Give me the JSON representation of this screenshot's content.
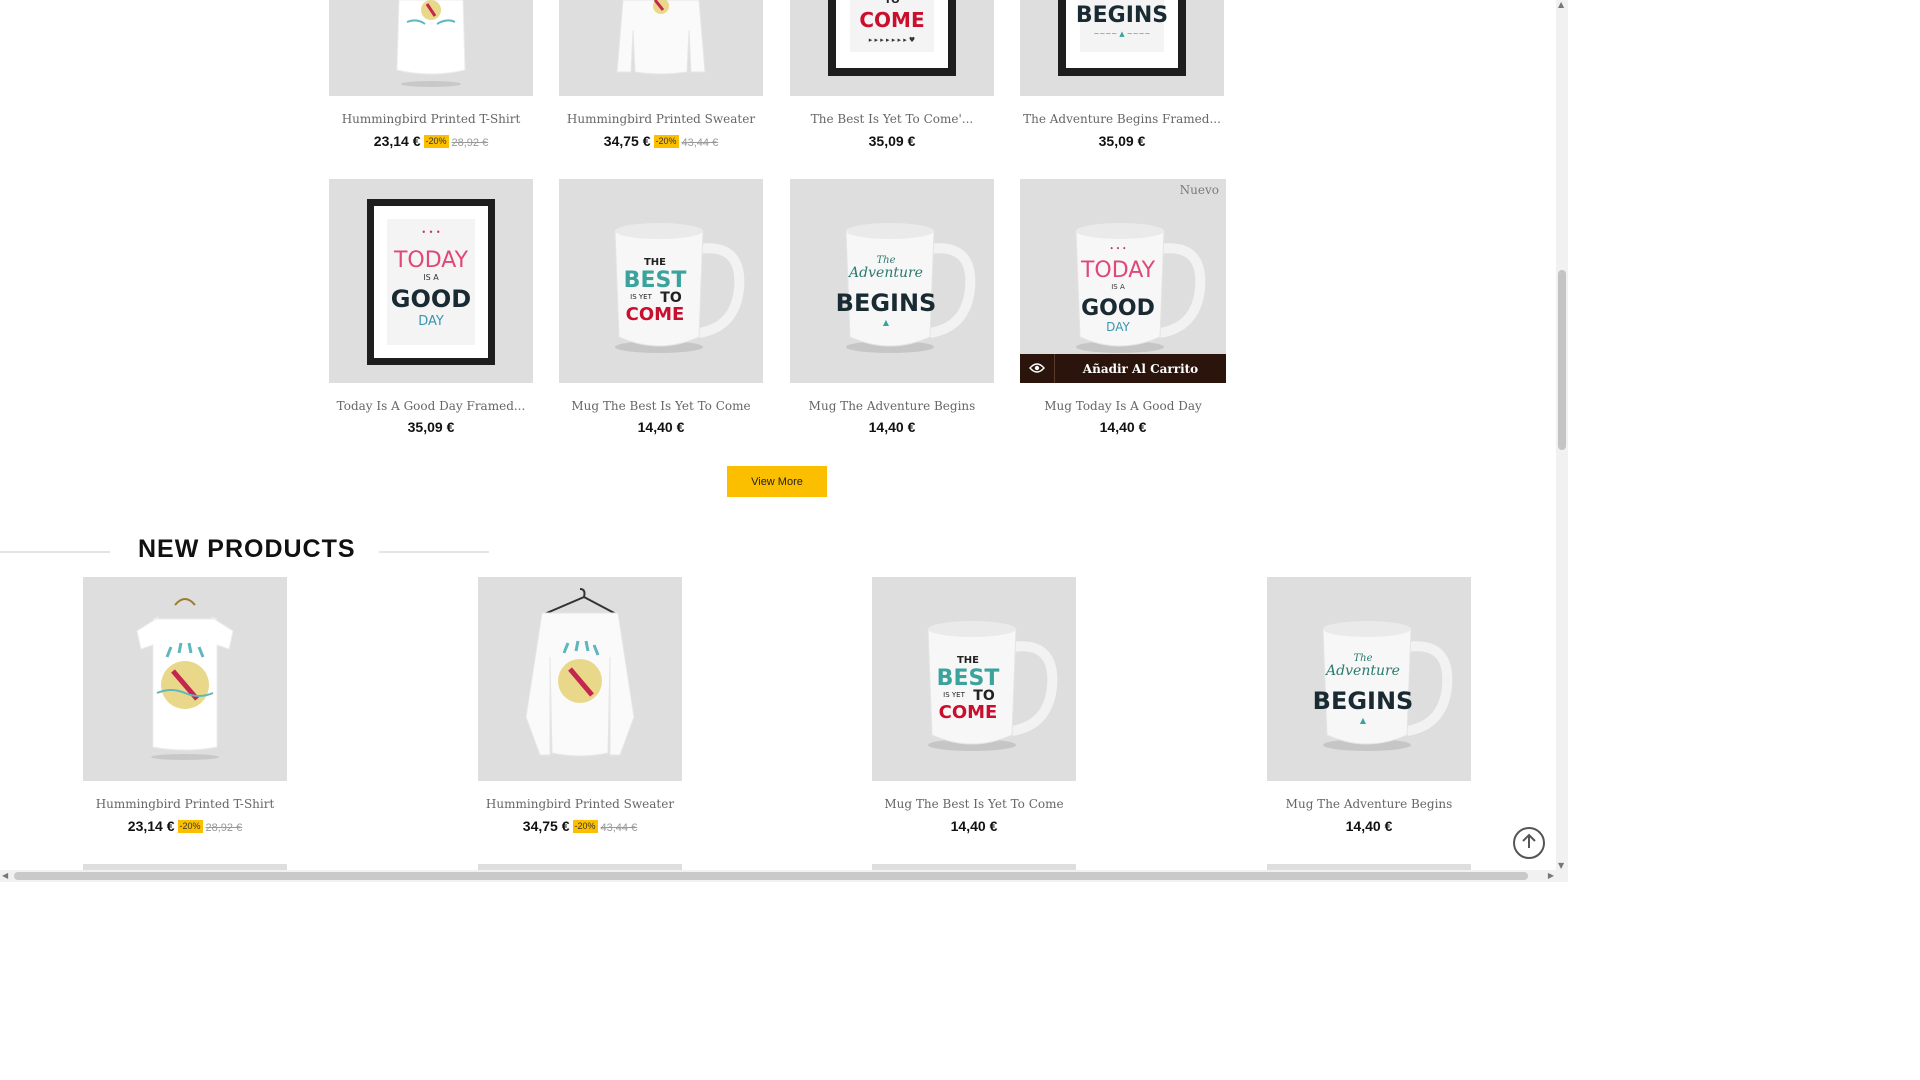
{
  "top_grid": [
    {
      "name": "Hummingbird Printed T-Shirt",
      "price": "23,14 €",
      "discount": "-20%",
      "old_price": "28,92 €",
      "image": "tshirt-hummingbird"
    },
    {
      "name": "Hummingbird Printed Sweater",
      "price": "34,75 €",
      "discount": "-20%",
      "old_price": "43,44 €",
      "image": "sweater-hummingbird"
    },
    {
      "name": "The Best Is Yet To Come'...",
      "price": "35,09 €",
      "image": "frame-best-is-yet-to-come"
    },
    {
      "name": "The Adventure Begins Framed...",
      "price": "35,09 €",
      "image": "frame-adventure-begins"
    },
    {
      "name": "Today Is A Good Day Framed...",
      "price": "35,09 €",
      "image": "frame-today-good-day"
    },
    {
      "name": "Mug The Best Is Yet To Come",
      "price": "14,40 €",
      "image": "mug-best-is-yet-to-come"
    },
    {
      "name": "Mug The Adventure Begins",
      "price": "14,40 €",
      "image": "mug-adventure-begins"
    },
    {
      "name": "Mug Today Is A Good Day",
      "price": "14,40 €",
      "badge": "Nuevo",
      "cart_label": "Añadir Al Carrito",
      "image": "mug-today-good-day"
    }
  ],
  "view_more_label": "View More",
  "new_products": {
    "title": "NEW PRODUCTS",
    "items": [
      {
        "name": "Hummingbird Printed T-Shirt",
        "price": "23,14 €",
        "discount": "-20%",
        "old_price": "28,92 €",
        "image": "tshirt-hummingbird"
      },
      {
        "name": "Hummingbird Printed Sweater",
        "price": "34,75 €",
        "discount": "-20%",
        "old_price": "43,44 €",
        "image": "sweater-hummingbird"
      },
      {
        "name": "Mug The Best Is Yet To Come",
        "price": "14,40 €",
        "image": "mug-best-is-yet-to-come"
      },
      {
        "name": "Mug The Adventure Begins",
        "price": "14,40 €",
        "image": "mug-adventure-begins"
      }
    ]
  },
  "art": {
    "frame1_top": "TO",
    "frame1_bottom": "COME",
    "frame2_top": "BEGINS",
    "today_1": "TODAY",
    "today_2": "IS A",
    "today_3": "GOOD",
    "today_4": "DAY",
    "best_1": "THE",
    "best_2": "BEST",
    "best_3": "IS YET",
    "best_4": "TO",
    "best_5": "COME",
    "adv_1": "The",
    "adv_2": "Adventure",
    "adv_3": "BEGINS"
  },
  "icons": {
    "eye": "eye-icon",
    "to_top": "arrow-up-circle-icon"
  },
  "colors": {
    "accent": "#fbbf00",
    "cart_bar": "#2a140c",
    "tile_bg": "#dedede"
  }
}
